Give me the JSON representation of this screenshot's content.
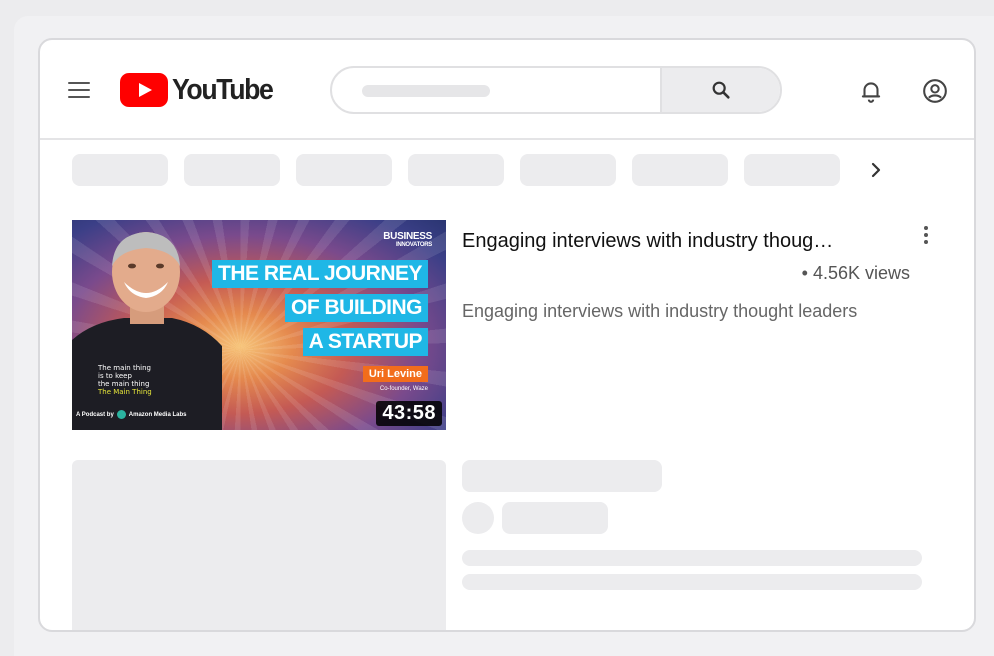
{
  "header": {
    "menu_icon": "menu-icon",
    "logo_text": "YouTube",
    "search": {
      "icon": "search-icon"
    },
    "notifications_icon": "bell-icon",
    "account_icon": "account-icon"
  },
  "chips": {
    "count": 7,
    "next_icon": "chevron-right-icon"
  },
  "video": {
    "title": "Engaging interviews with industry thoug…",
    "meta": "• 4.56K views",
    "description": "Engaging interviews with industry thought leaders",
    "duration": "43:58",
    "thumbnail": {
      "brand_top": "BUSINESS",
      "brand_bottom": "INNOVATORS",
      "headline": [
        "THE REAL JOURNEY",
        "OF BUILDING",
        "A STARTUP"
      ],
      "guest": "Uri Levine",
      "guest_title": "Co-founder, Waze",
      "shirt_lines": [
        "The main thing",
        "is to keep",
        "the main thing",
        "The Main Thing"
      ],
      "podcast": "A Podcast by",
      "network": "Amazon Media Labs"
    }
  },
  "colors": {
    "youtube_red": "#ff0000",
    "headline_blue": "#1fb7e6",
    "guest_orange": "#f26d1c",
    "skeleton": "#ececee"
  }
}
